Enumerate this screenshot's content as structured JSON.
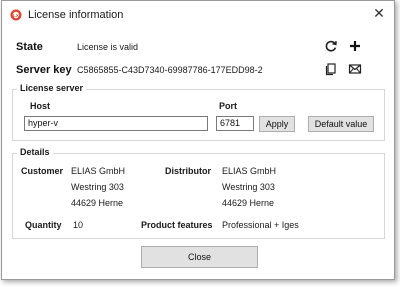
{
  "window": {
    "title": "License information"
  },
  "state": {
    "label": "State",
    "value": "License is valid"
  },
  "server_key": {
    "label": "Server key",
    "value": "C5865855-C43D7340-69987786-177EDD98-2"
  },
  "icons": {
    "refresh": "refresh-icon",
    "add": "plus-icon",
    "copy": "copy-icon",
    "mail": "mail-icon",
    "close": "close-icon",
    "app": "app-logo-icon"
  },
  "license_server": {
    "title": "License server",
    "host_label": "Host",
    "host_value": "hyper-v",
    "port_label": "Port",
    "port_value": "6781",
    "apply_label": "Apply",
    "default_label": "Default value"
  },
  "details": {
    "title": "Details",
    "customer_label": "Customer",
    "customer_lines": [
      "ELIAS GmbH",
      "Westring 303",
      "44629 Herne"
    ],
    "distributor_label": "Distributor",
    "distributor_lines": [
      "ELIAS GmbH",
      "Westring 303",
      "44629 Herne"
    ],
    "quantity_label": "Quantity",
    "quantity_value": "10",
    "features_label": "Product features",
    "features_value": "Professional + Iges"
  },
  "footer": {
    "close_label": "Close"
  },
  "colors": {
    "accent": "#d9534f",
    "button_bg": "#e1e1e1",
    "border": "#d6d6d6"
  }
}
